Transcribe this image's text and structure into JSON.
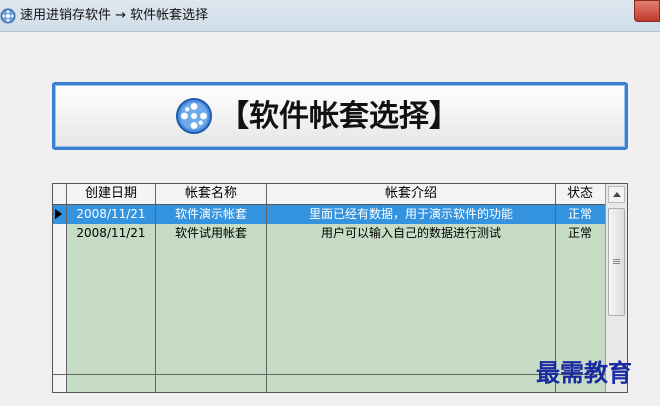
{
  "window": {
    "title": "速用进销存软件 → 软件帐套选择",
    "icon": "film-reel-icon"
  },
  "header": {
    "title": "【软件帐套选择】",
    "icon": "film-reel-icon"
  },
  "grid": {
    "columns": [
      "创建日期",
      "帐套名称",
      "帐套介绍",
      "状态"
    ],
    "rows": [
      {
        "date": "2008/11/21",
        "name": "软件演示帐套",
        "intro": "里面已经有数据，用于演示软件的功能",
        "status": "正常",
        "selected": true
      },
      {
        "date": "2008/11/21",
        "name": "软件试用帐套",
        "intro": "用户可以输入自己的数据进行测试",
        "status": "正常",
        "selected": false
      }
    ],
    "row_background": "#c6dcc4",
    "selected_background": "#3393df"
  },
  "watermark": "最需教育",
  "colors": {
    "header_border": "#3c7fd0",
    "watermark": "#1a2aa0"
  }
}
